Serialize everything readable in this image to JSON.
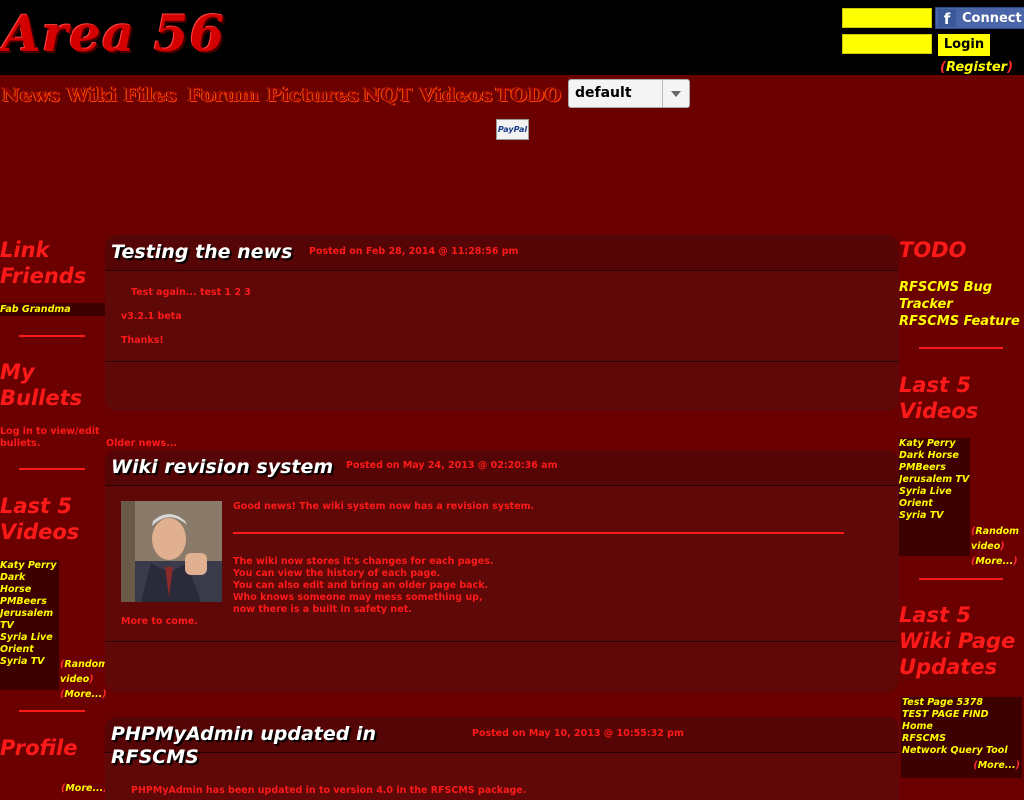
{
  "header": {
    "logo_text": "Area 56",
    "fb_connect_label": "Connect",
    "login_label": "Login",
    "register_label": "Register"
  },
  "nav": {
    "items": [
      "News",
      "Wiki",
      "Files",
      "Forum",
      "Pictures",
      "NQT Videos",
      "TODO"
    ],
    "theme_selected": "default",
    "paypal_label": "PayPal"
  },
  "left": {
    "link_friends_title": "Link Friends",
    "friends": [
      "Fab Grandma"
    ],
    "bullets_title": "My Bullets",
    "bullets_text": "Log in to view/edit bullets.",
    "videos_title": "Last 5 Videos",
    "videos": [
      "Katy Perry",
      "Dark Horse PMBeers",
      "Jerusalem TV",
      "Syria Live",
      "Orient",
      "Syria TV"
    ],
    "random_video": "Random video",
    "more": "More...",
    "profile_title": "Profile",
    "profile_more": "More..."
  },
  "right": {
    "todo_title": "TODO",
    "todo_items": [
      "RFSCMS Bug Tracker",
      "RFSCMS Feature"
    ],
    "videos_title": "Last 5 Videos",
    "videos": [
      "Katy Perry",
      "Dark Horse PMBeers",
      "Jerusalem TV",
      "Syria Live",
      "Orient",
      "Syria TV"
    ],
    "random_video": "Random video",
    "more": "More...",
    "wiki_title": "Last 5 Wiki Page Updates",
    "wiki_items": [
      "Test Page 5378",
      "TEST PAGE FIND Home",
      "RFSCMS",
      "Network Query Tool"
    ],
    "wiki_more": "More..."
  },
  "posts": [
    {
      "title": "Testing the news",
      "date": "Posted on Feb 28, 2014 @ 11:28:56 pm",
      "lines": [
        "Test again... test 1 2 3",
        "v3.2.1 beta",
        "Thanks!"
      ]
    },
    {
      "title": "Wiki revision system",
      "date": "Posted on May 24, 2013 @ 02:20:36 am",
      "intro": "Good news! The wiki system now has a revision system.",
      "lines": [
        "The wiki now stores it's changes for each pages.",
        "You can view the history of each page.",
        "You can also edit and bring an older page back.",
        "Who knows someone may mess something up,",
        "now there is a built in safety net."
      ],
      "outro": "More to come."
    },
    {
      "title": "PHPMyAdmin updated in RFSCMS",
      "date": "Posted on May 10, 2013 @ 10:55:32 pm",
      "lines": [
        "PHPMyAdmin has been updated in to version 4.0 in the RFSCMS package."
      ]
    }
  ],
  "older_news": "Older news..."
}
